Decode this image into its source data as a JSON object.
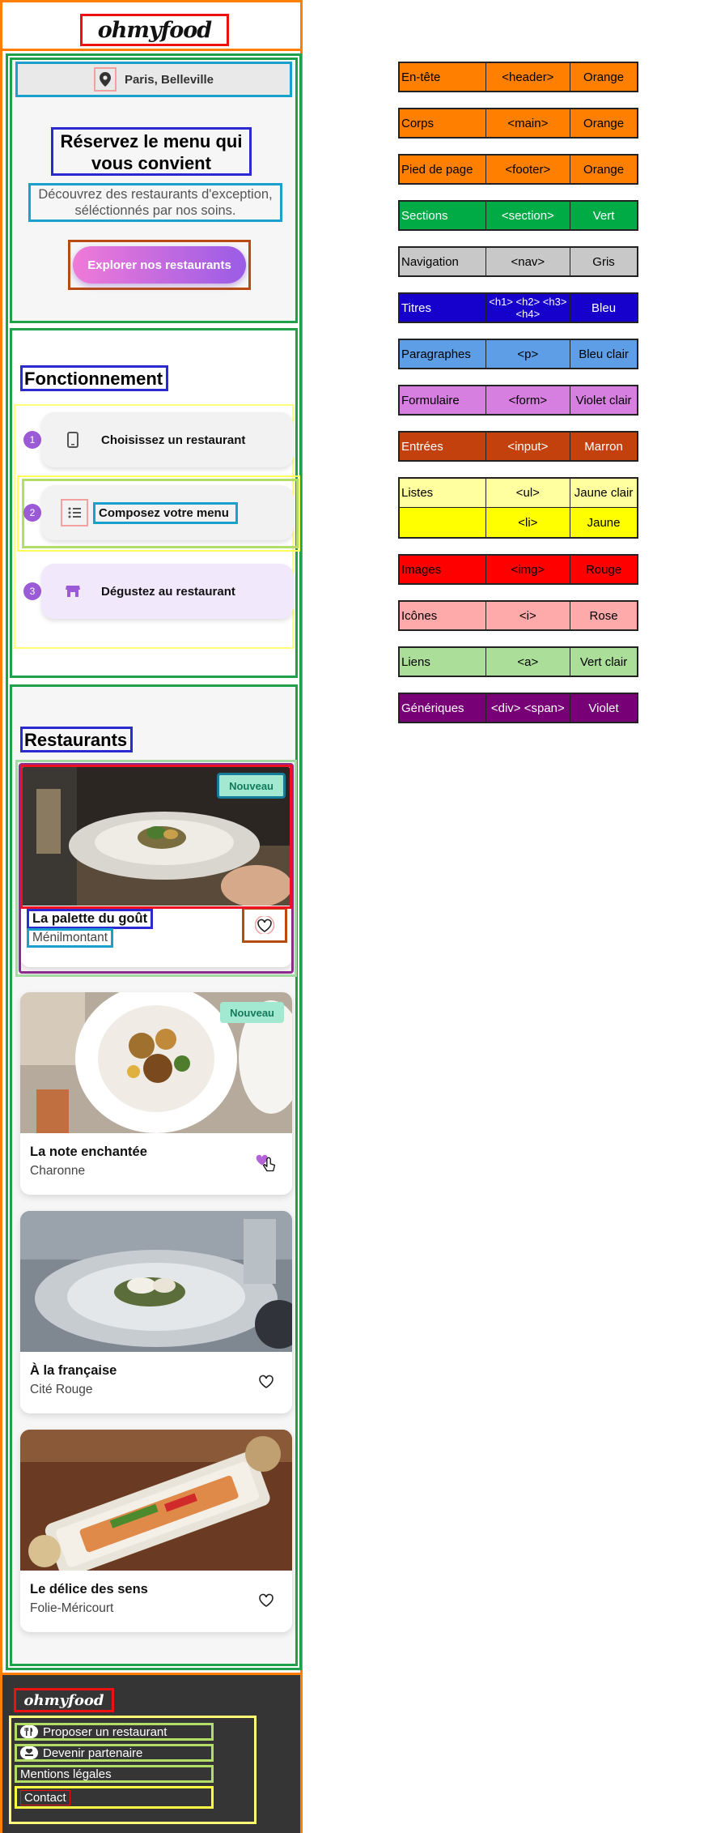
{
  "header": {
    "logo": "ohmyfood"
  },
  "nav": {
    "location": "Paris, Belleville",
    "pin_icon": "map-pin-icon"
  },
  "hero": {
    "title": "Réservez le menu qui vous convient",
    "subtitle": "Découvrez des restaurants d'exception, séléctionnés par nos soins.",
    "cta": "Explorer nos restaurants"
  },
  "how": {
    "title": "Fonctionnement",
    "steps": [
      {
        "number": "1",
        "icon": "mobile-phone-icon",
        "label": "Choisissez un restaurant"
      },
      {
        "number": "2",
        "icon": "list-icon",
        "label": "Composez votre menu"
      },
      {
        "number": "3",
        "icon": "storefront-icon",
        "label": "Dégustez au restaurant"
      }
    ]
  },
  "restaurants": {
    "title": "Restaurants",
    "items": [
      {
        "name": "La palette du goût",
        "district": "Ménilmontant",
        "badge": "Nouveau",
        "favorite": false
      },
      {
        "name": "La note enchantée",
        "district": "Charonne",
        "badge": "Nouveau",
        "favorite": true
      },
      {
        "name": "À la française",
        "district": "Cité Rouge",
        "badge": "",
        "favorite": false
      },
      {
        "name": "Le délice des sens",
        "district": "Folie-Méricourt",
        "badge": "",
        "favorite": false
      }
    ]
  },
  "footer": {
    "logo": "ohmyfood",
    "links": [
      {
        "label": "Proposer un restaurant",
        "icon": "utensils-icon"
      },
      {
        "label": "Devenir partenaire",
        "icon": "hand-holding-heart-icon"
      },
      {
        "label": "Mentions légales",
        "icon": ""
      },
      {
        "label": "Contact",
        "icon": ""
      }
    ]
  },
  "legend": [
    {
      "label": "En-tête",
      "tag": "<header>",
      "color_name": "Orange",
      "color": "#ff8000",
      "text_color": "#000000"
    },
    {
      "label": "Corps",
      "tag": "<main>",
      "color_name": "Orange",
      "color": "#ff8000",
      "text_color": "#000000"
    },
    {
      "label": "Pied de page",
      "tag": "<footer>",
      "color_name": "Orange",
      "color": "#ff8000",
      "text_color": "#000000"
    },
    {
      "label": "Sections",
      "tag": "<section>",
      "color_name": "Vert",
      "color": "#00aa44",
      "text_color": "#ffffff"
    },
    {
      "label": "Navigation",
      "tag": "<nav>",
      "color_name": "Gris",
      "color": "#c8c8c8",
      "text_color": "#000000"
    },
    {
      "label": "Titres",
      "tag": "<h1> <h2> <h3> <h4>",
      "color_name": "Bleu",
      "color": "#1500cc",
      "text_color": "#ffffff"
    },
    {
      "label": "Paragraphes",
      "tag": "<p>",
      "color_name": "Bleu clair",
      "color": "#5e9ee6",
      "text_color": "#000000"
    },
    {
      "label": "Formulaire",
      "tag": "<form>",
      "color_name": "Violet clair",
      "color": "#d67fe0",
      "text_color": "#000000"
    },
    {
      "label": "Entrées",
      "tag": "<input>",
      "color_name": "Marron",
      "color": "#c2410c",
      "text_color": "#ffffff"
    },
    {
      "label": "Listes",
      "tag": "<ul>",
      "color_name": "Jaune clair",
      "color": "#ffffa0",
      "text_color": "#000000"
    },
    {
      "label": "",
      "tag": "<li>",
      "color_name": "Jaune",
      "color": "#ffff00",
      "text_color": "#000000"
    },
    {
      "label": "Images",
      "tag": "<img>",
      "color_name": "Rouge",
      "color": "#ff0000",
      "text_color": "#000000"
    },
    {
      "label": "Icônes",
      "tag": "<i>",
      "color_name": "Rose",
      "color": "#ffaaaa",
      "text_color": "#000000"
    },
    {
      "label": "Liens",
      "tag": "<a>",
      "color_name": "Vert clair",
      "color": "#aade99",
      "text_color": "#000000"
    },
    {
      "label": "Génériques",
      "tag": "<div> <span>",
      "color_name": "Violet",
      "color": "#770077",
      "text_color": "#ffffff"
    }
  ]
}
